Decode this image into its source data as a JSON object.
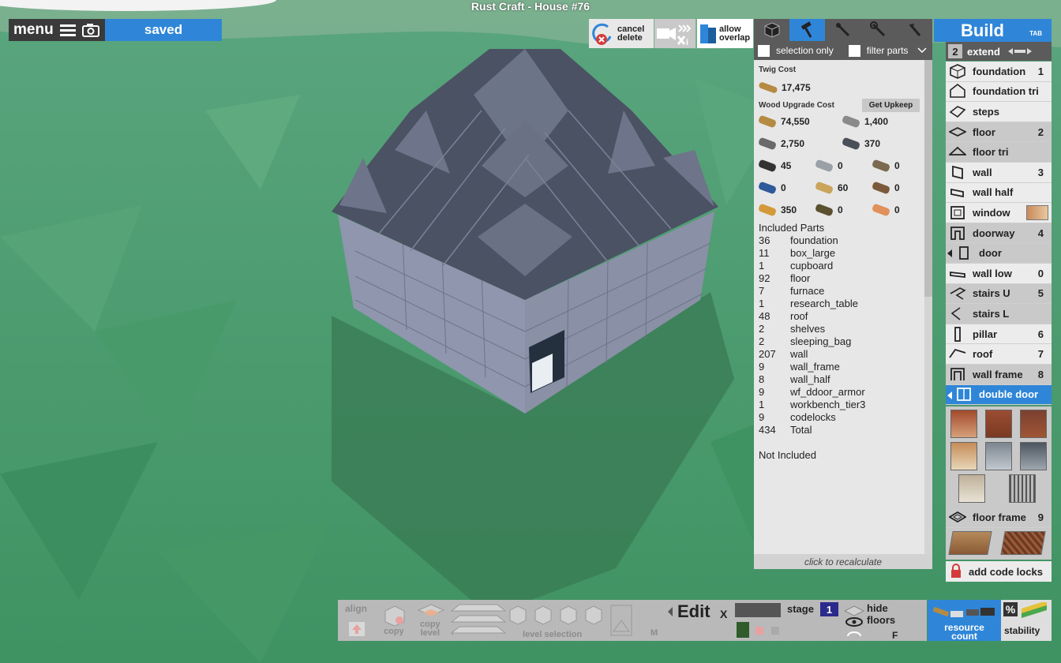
{
  "window": {
    "title": "Rust Craft - House #76"
  },
  "top_left": {
    "menu_label": "menu",
    "status": "saved"
  },
  "toolbar": {
    "cancel_delete": [
      "cancel",
      "delete"
    ],
    "allow_overlap": [
      "allow",
      "overlap"
    ],
    "tabs": [
      "cube-icon",
      "hammer-icon",
      "wrench-icon",
      "spanner-icon",
      "pliers-icon"
    ],
    "active_tab": 1
  },
  "filters": {
    "selection_only": "selection only",
    "filter_parts": "filter parts"
  },
  "cost_panel": {
    "twig_label": "Twig Cost",
    "twig_value": "17,475",
    "wood_label": "Wood Upgrade Cost",
    "get_upkeep": "Get Upkeep",
    "resources": [
      {
        "icon": "wood-icon",
        "value": "74,550"
      },
      {
        "icon": "stone-icon",
        "value": "1,400"
      },
      {
        "icon": "metal-frags-icon",
        "value": "2,750"
      },
      {
        "icon": "hq-metal-icon",
        "value": "370"
      },
      {
        "icon": "gear-icon",
        "value": "45"
      },
      {
        "icon": "metal-blade-icon",
        "value": "0"
      },
      {
        "icon": "rope-icon",
        "value": "0"
      },
      {
        "icon": "tarp-icon",
        "value": "0"
      },
      {
        "icon": "cloth-icon",
        "value": "60"
      },
      {
        "icon": "pipe-icon",
        "value": "0"
      },
      {
        "icon": "fat-icon",
        "value": "350"
      },
      {
        "icon": "spring-icon",
        "value": "0"
      },
      {
        "icon": "leather-icon",
        "value": "0"
      }
    ],
    "included_title": "Included Parts",
    "parts": [
      {
        "q": "36",
        "name": "foundation"
      },
      {
        "q": "11",
        "name": "box_large"
      },
      {
        "q": "1",
        "name": "cupboard"
      },
      {
        "q": "92",
        "name": "floor"
      },
      {
        "q": "7",
        "name": "furnace"
      },
      {
        "q": "1",
        "name": "research_table"
      },
      {
        "q": "48",
        "name": "roof"
      },
      {
        "q": "2",
        "name": "shelves"
      },
      {
        "q": "2",
        "name": "sleeping_bag"
      },
      {
        "q": "207",
        "name": "wall"
      },
      {
        "q": "9",
        "name": "wall_frame"
      },
      {
        "q": "8",
        "name": "wall_half"
      },
      {
        "q": "9",
        "name": "wf_ddoor_armor"
      },
      {
        "q": "1",
        "name": "workbench_tier3"
      },
      {
        "q": "9",
        "name": "codelocks"
      },
      {
        "q": "434",
        "name": "Total"
      }
    ],
    "not_included": "Not Included",
    "recalc": "click to recalculate"
  },
  "build": {
    "title": "Build",
    "tab_hint": "TAB",
    "extend_count": "2",
    "extend_label": "extend",
    "items": [
      {
        "label": "foundation",
        "key": "1",
        "tone": "light",
        "icon": "cube-icon"
      },
      {
        "label": "foundation tri",
        "key": "",
        "tone": "light",
        "icon": "house-icon"
      },
      {
        "label": "steps",
        "key": "",
        "tone": "light",
        "icon": "steps-icon"
      },
      {
        "label": "floor",
        "key": "2",
        "tone": "dark",
        "icon": "floor-icon"
      },
      {
        "label": "floor tri",
        "key": "",
        "tone": "dark",
        "icon": "floor-tri-icon"
      },
      {
        "label": "wall",
        "key": "3",
        "tone": "light",
        "icon": "wall-icon"
      },
      {
        "label": "wall half",
        "key": "",
        "tone": "light",
        "icon": "wall-half-icon"
      },
      {
        "label": "window",
        "key": "",
        "tone": "light",
        "icon": "window-icon"
      },
      {
        "label": "doorway",
        "key": "4",
        "tone": "dark",
        "icon": "doorway-icon"
      },
      {
        "label": "door",
        "key": "",
        "tone": "dark",
        "icon": "door-icon"
      },
      {
        "label": "wall low",
        "key": "0",
        "tone": "light",
        "icon": "wall-low-icon"
      },
      {
        "label": "stairs U",
        "key": "5",
        "tone": "dark",
        "icon": "stairs-u-icon"
      },
      {
        "label": "stairs L",
        "key": "",
        "tone": "dark",
        "icon": "stairs-l-icon"
      },
      {
        "label": "pillar",
        "key": "6",
        "tone": "light",
        "icon": "pillar-icon"
      },
      {
        "label": "roof",
        "key": "7",
        "tone": "light",
        "icon": "roof-icon"
      },
      {
        "label": "wall frame",
        "key": "8",
        "tone": "dark",
        "icon": "wall-frame-icon"
      },
      {
        "label": "double door",
        "key": "",
        "tone": "sel",
        "icon": "double-door-icon"
      }
    ],
    "floor_frame_label": "floor frame",
    "floor_frame_key": "9",
    "add_code_locks": "add code locks"
  },
  "bottom_bar": {
    "align": "align",
    "copy": "copy",
    "copy_level": [
      "copy",
      "level"
    ],
    "level_selection": "level selection",
    "m_key": "M",
    "edit": "Edit",
    "x": "X",
    "stage_label": "stage",
    "stage_value": "1",
    "hide_floors": [
      "hide",
      "floors"
    ],
    "f_key": "F",
    "resource_count": [
      "resource",
      "count"
    ],
    "percent": "%",
    "stability": "stability"
  },
  "colors": {
    "accent": "#2f86d8",
    "panel": "#e7e7e7",
    "grass": "#4a9a6a"
  }
}
